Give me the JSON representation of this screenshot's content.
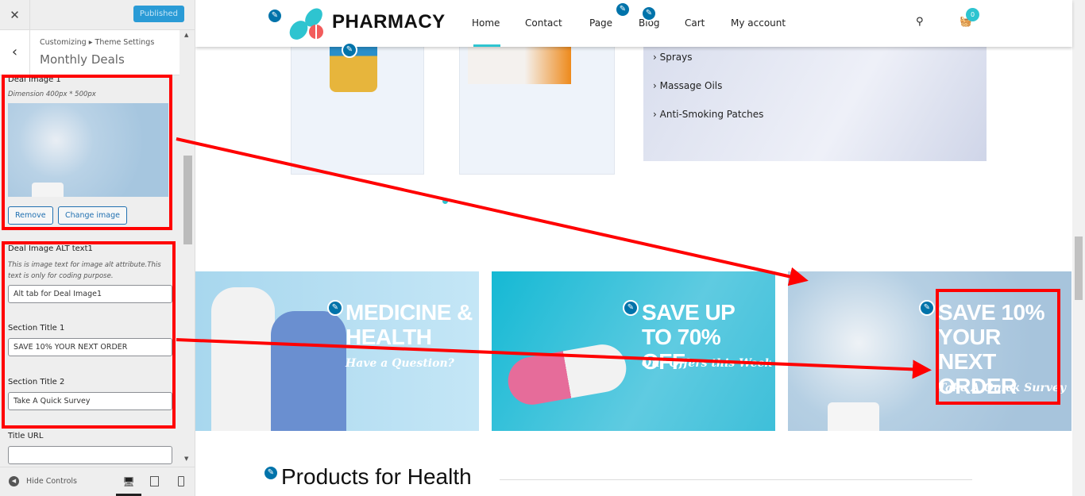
{
  "sidebar": {
    "close_label": "✕",
    "publish_label": "Published",
    "breadcrumb": "Customizing ▸ Theme Settings",
    "title": "Monthly Deals",
    "deal_image": {
      "label": "Deal Image 1",
      "dimension": "Dimension 400px * 500px",
      "remove": "Remove",
      "change": "Change image"
    },
    "alt": {
      "label": "Deal Image ALT text1",
      "desc": "This is image text for image alt attribute.This text is only for coding purpose.",
      "value": "Alt tab for Deal Image1"
    },
    "title1": {
      "label": "Section Title 1",
      "value": "SAVE 10% YOUR NEXT ORDER"
    },
    "title2": {
      "label": "Section Title 2",
      "value": "Take A Quick Survey"
    },
    "url": {
      "label": "Title URL",
      "value": ""
    },
    "hide_controls": "Hide Controls"
  },
  "site": {
    "brand": "PHARMACY",
    "menu": [
      "Home",
      "Contact",
      "Page",
      "Blog",
      "Cart",
      "My account"
    ],
    "cart_count": "0",
    "categories": [
      "Sprays",
      "Massage Oils",
      "Anti-Smoking Patches"
    ],
    "banners": [
      {
        "title": "MEDICINE & HEALTH",
        "subtitle": "Have a Question?"
      },
      {
        "title": "SAVE UP TO 70% OFF",
        "subtitle": "Our Offers this Week"
      },
      {
        "title": "SAVE 10% YOUR NEXT ORDER",
        "subtitle": "Take A Quick Survey"
      }
    ],
    "section_heading": "Products for Health"
  },
  "colors": {
    "accent": "#2ec4d0",
    "annotation": "#ff0000",
    "publish": "#2a9bd6"
  }
}
